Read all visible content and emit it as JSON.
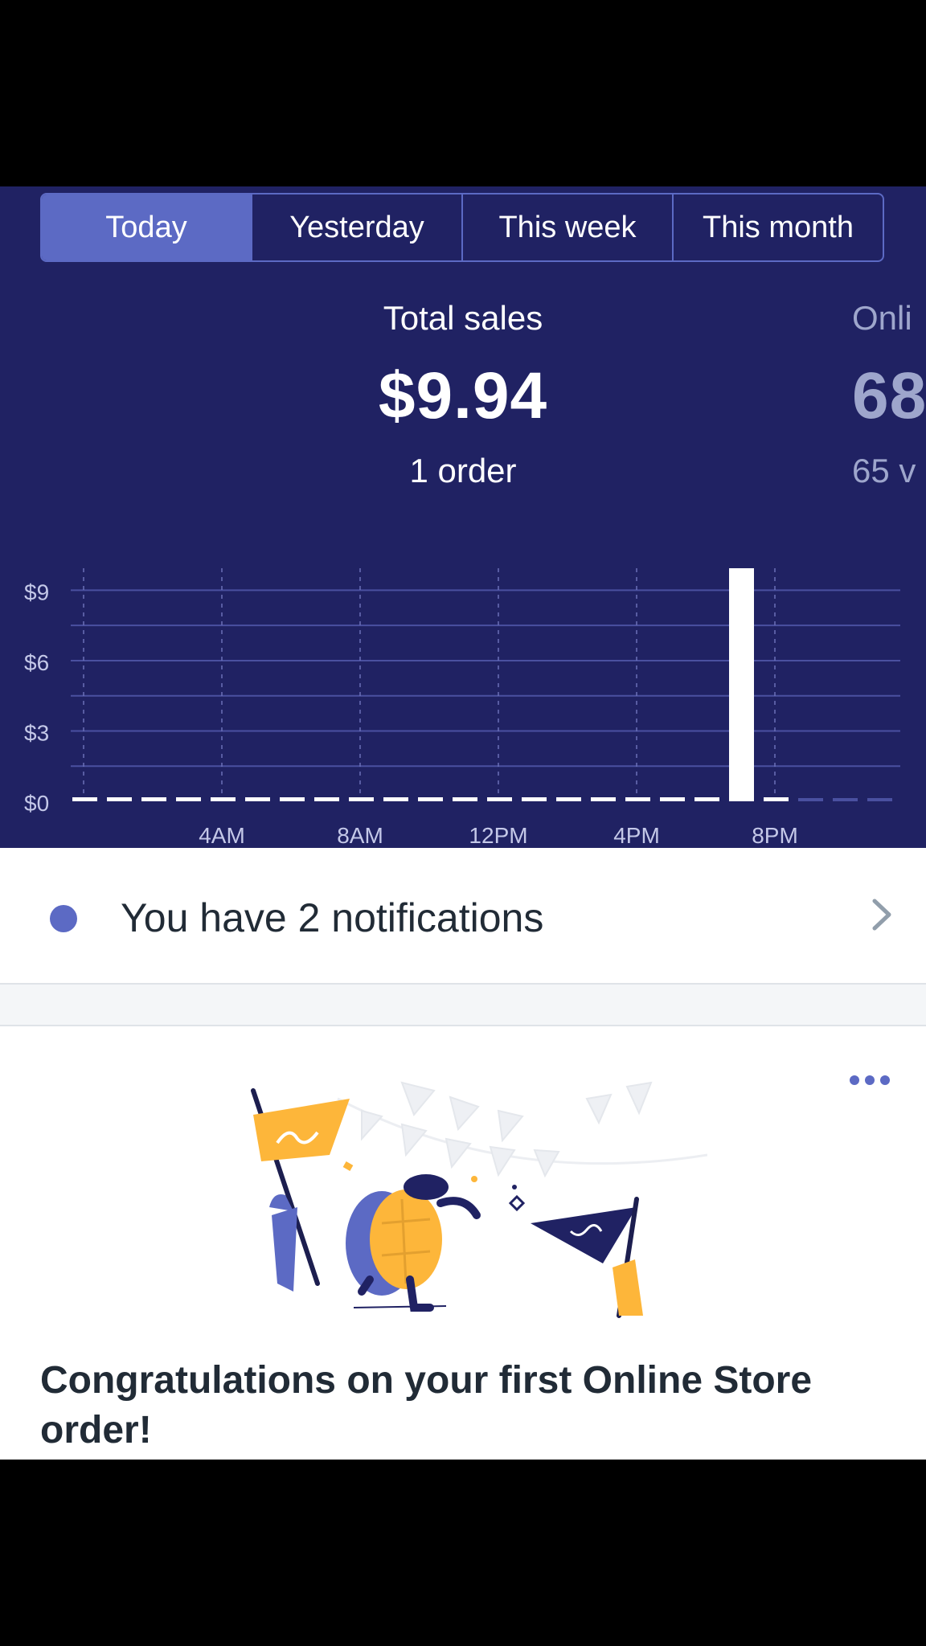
{
  "date_tabs": [
    "Today",
    "Yesterday",
    "This week",
    "This month"
  ],
  "active_tab": "Today",
  "metrics": {
    "total_sales": {
      "label": "Total sales",
      "value": "$9.94",
      "sub": "1 order"
    },
    "online": {
      "label": "Onli",
      "value": "68",
      "sub": "65 v"
    }
  },
  "chart_data": {
    "type": "bar",
    "x_ticks": [
      "4AM",
      "8AM",
      "12PM",
      "4PM",
      "8PM"
    ],
    "y_ticks": [
      "$9",
      "$6",
      "$3",
      "$0"
    ],
    "ylim": [
      0,
      9.94
    ],
    "bars": [
      {
        "hour": 0,
        "value": 0
      },
      {
        "hour": 1,
        "value": 0
      },
      {
        "hour": 2,
        "value": 0
      },
      {
        "hour": 3,
        "value": 0
      },
      {
        "hour": 4,
        "value": 0
      },
      {
        "hour": 5,
        "value": 0
      },
      {
        "hour": 6,
        "value": 0
      },
      {
        "hour": 7,
        "value": 0
      },
      {
        "hour": 8,
        "value": 0
      },
      {
        "hour": 9,
        "value": 0
      },
      {
        "hour": 10,
        "value": 0
      },
      {
        "hour": 11,
        "value": 0
      },
      {
        "hour": 12,
        "value": 0
      },
      {
        "hour": 13,
        "value": 0
      },
      {
        "hour": 14,
        "value": 0
      },
      {
        "hour": 15,
        "value": 0
      },
      {
        "hour": 16,
        "value": 0
      },
      {
        "hour": 17,
        "value": 0
      },
      {
        "hour": 18,
        "value": 0
      },
      {
        "hour": 19,
        "value": 9.94
      },
      {
        "hour": 20,
        "value": 0
      },
      {
        "hour": 21,
        "value": null
      },
      {
        "hour": 22,
        "value": null
      },
      {
        "hour": 23,
        "value": null
      }
    ],
    "grid": true
  },
  "notifications": {
    "text": "You have 2 notifications"
  },
  "card": {
    "title": "Congratulations on your first Online Store order!"
  },
  "colors": {
    "header_bg": "#202263",
    "accent": "#5c6ac4",
    "text": "#212b36"
  }
}
